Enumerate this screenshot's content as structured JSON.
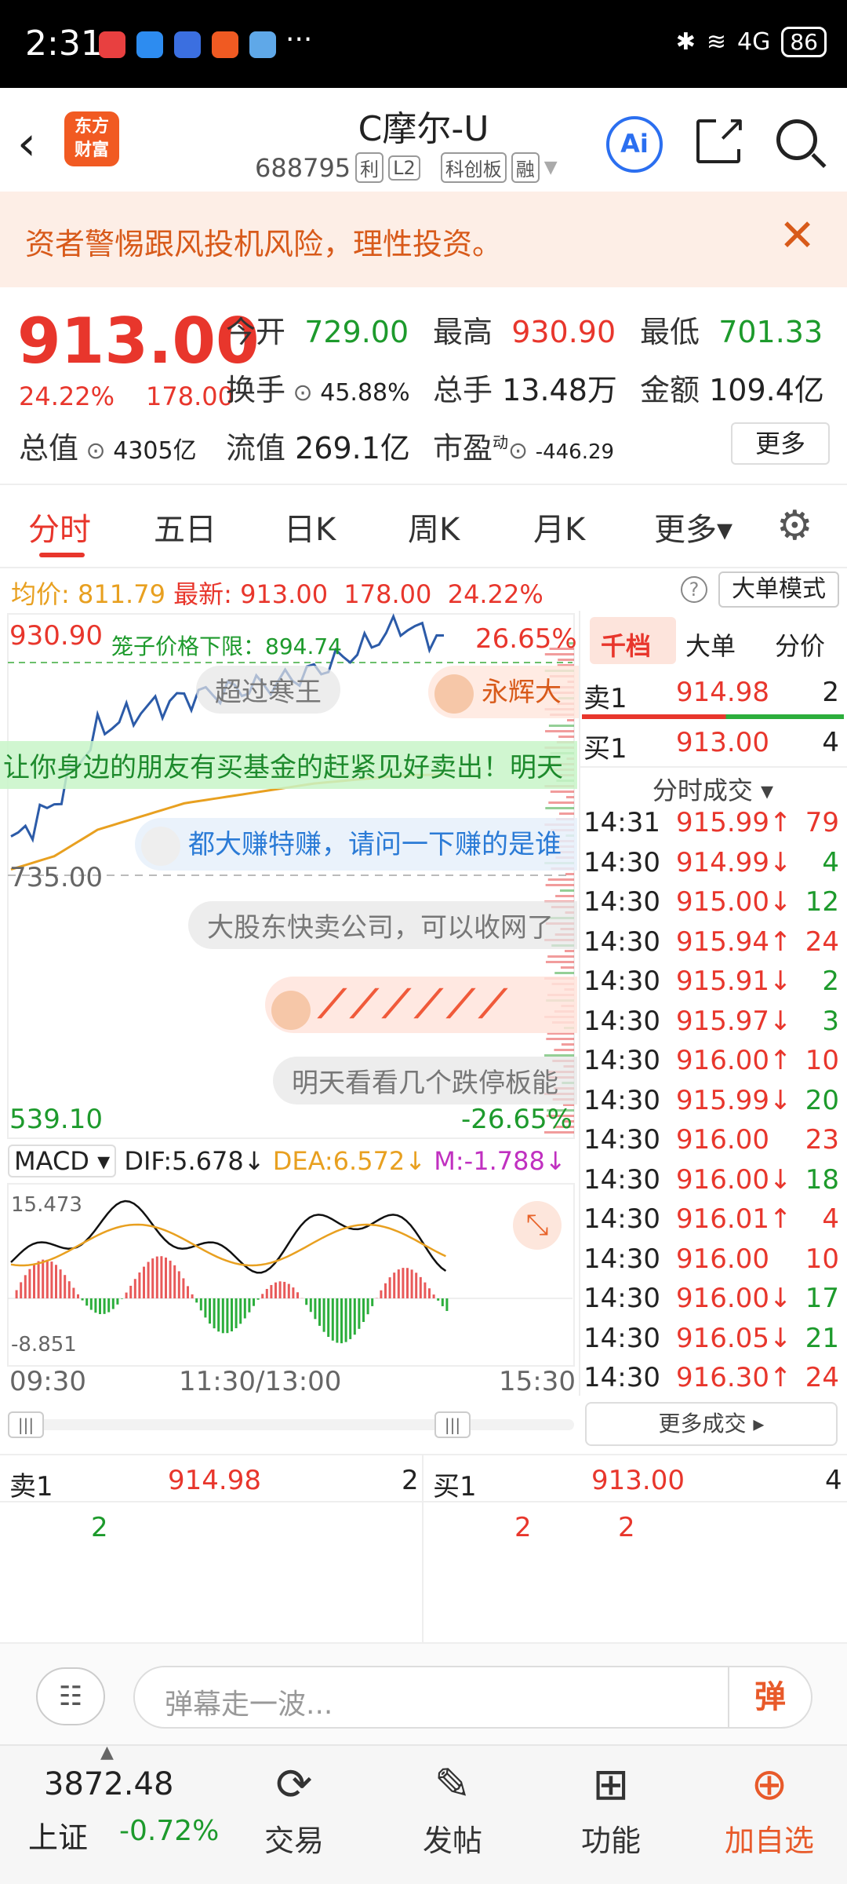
{
  "status": {
    "time": "2:31",
    "signal": "4G",
    "battery": "86"
  },
  "header": {
    "logo_line1": "东方",
    "logo_line2": "财富",
    "title": "C摩尔-U",
    "code": "688795",
    "tags": [
      "利",
      "L2",
      "科创板",
      "融"
    ],
    "ai_label": "Ai"
  },
  "warning": {
    "text": "资者警惕跟风投机风险，理性投资。",
    "close": "✕"
  },
  "quote": {
    "price": "913.00",
    "change_pct": "24.22%",
    "change": "178.00",
    "open_label": "今开",
    "open": "729.00",
    "high_label": "最高",
    "high": "930.90",
    "low_label": "最低",
    "low": "701.33",
    "turnover_label": "换手",
    "turnover": "45.88%",
    "volume_label": "总手",
    "volume": "13.48万",
    "amount_label": "金额",
    "amount": "109.4亿",
    "mktcap_label": "总值",
    "mktcap": "4305亿",
    "float_label": "流值",
    "float_value": "269.1亿",
    "pe_label": "市盈",
    "pe_sup": "动",
    "pe": "-446.29",
    "more": "更多"
  },
  "tabs": [
    "分时",
    "五日",
    "日K",
    "周K",
    "月K",
    "更多▾"
  ],
  "info": {
    "avg_label": "均价:",
    "avg": "811.79",
    "latest_label": "最新:",
    "latest": "913.00",
    "chg": "178.00",
    "pct": "24.22%",
    "bigorder_btn": "大单模式"
  },
  "chart": {
    "top_price": "930.90",
    "top_pct": "26.65%",
    "cage_text": "笼子价格下限：894.74",
    "mid_price": "735.00",
    "bottom_price": "539.10",
    "bottom_pct": "-26.65%",
    "danmu": [
      "超过寒王",
      "永辉大",
      "让你身边的朋友有买基金的赶紧见好卖出！明天",
      "都大赚特赚，请问一下赚的是谁",
      "大股东快卖公司，可以收网了",
      "明天看看几个跌停板能"
    ],
    "macd_label": "MACD ▾",
    "dif": "DIF:5.678↓",
    "dea": "DEA:6.572↓",
    "m": "M:-1.788↓",
    "macd_top": "15.473",
    "macd_bottom": "-8.851",
    "time_labels": [
      "09:30",
      "11:30/13:00",
      "15:30"
    ]
  },
  "chart_data": {
    "type": "line",
    "title": "",
    "x": [
      "09:30",
      "11:30/13:00",
      "15:30"
    ],
    "series": [
      {
        "name": "最新",
        "values": [
          760,
          790,
          845,
          860,
          870,
          875,
          880,
          890,
          905,
          925,
          913
        ]
      },
      {
        "name": "均价",
        "values": [
          740,
          750,
          770,
          780,
          790,
          795,
          800,
          805,
          808,
          811,
          811.79
        ]
      }
    ],
    "ylim": [
      539.1,
      930.9
    ],
    "xlabel": "",
    "ylabel": ""
  },
  "panel": {
    "tabs": [
      "千档",
      "大单",
      "分价"
    ],
    "sell1_label": "卖1",
    "sell1_price": "914.98",
    "sell1_vol": "2",
    "buy1_label": "买1",
    "buy1_price": "913.00",
    "buy1_vol": "4",
    "ticks_title": "分时成交 ▾",
    "ticks": [
      {
        "t": "14:31",
        "p": "915.99↑",
        "v": "79",
        "up": true
      },
      {
        "t": "14:30",
        "p": "914.99↓",
        "v": "4",
        "up": false
      },
      {
        "t": "14:30",
        "p": "915.00↓",
        "v": "12",
        "up": false
      },
      {
        "t": "14:30",
        "p": "915.94↑",
        "v": "24",
        "up": true
      },
      {
        "t": "14:30",
        "p": "915.91↓",
        "v": "2",
        "up": false
      },
      {
        "t": "14:30",
        "p": "915.97↓",
        "v": "3",
        "up": false
      },
      {
        "t": "14:30",
        "p": "916.00↑",
        "v": "10",
        "up": true
      },
      {
        "t": "14:30",
        "p": "915.99↓",
        "v": "20",
        "up": false
      },
      {
        "t": "14:30",
        "p": "916.00",
        "v": "23",
        "up": true
      },
      {
        "t": "14:30",
        "p": "916.00↓",
        "v": "18",
        "up": false
      },
      {
        "t": "14:30",
        "p": "916.01↑",
        "v": "4",
        "up": true
      },
      {
        "t": "14:30",
        "p": "916.00",
        "v": "10",
        "up": true
      },
      {
        "t": "14:30",
        "p": "916.00↓",
        "v": "17",
        "up": false
      },
      {
        "t": "14:30",
        "p": "916.05↓",
        "v": "21",
        "up": false
      },
      {
        "t": "14:30",
        "p": "916.30↑",
        "v": "24",
        "up": true
      }
    ],
    "more_ticks": "更多成交 ▸"
  },
  "book": {
    "sell_label": "卖1",
    "sell_price": "914.98",
    "sell_vol": "2",
    "sell_sub": "2",
    "buy_label": "买1",
    "buy_price": "913.00",
    "buy_vol": "4",
    "buy_sub1": "2",
    "buy_sub2": "2"
  },
  "comment": {
    "placeholder": "弹幕走一波...",
    "dan_btn": "弹"
  },
  "nav": {
    "index_value": "3872.48",
    "index_name": "上证",
    "index_pct": "-0.72%",
    "items": [
      "交易",
      "发帖",
      "功能",
      "加自选"
    ]
  }
}
